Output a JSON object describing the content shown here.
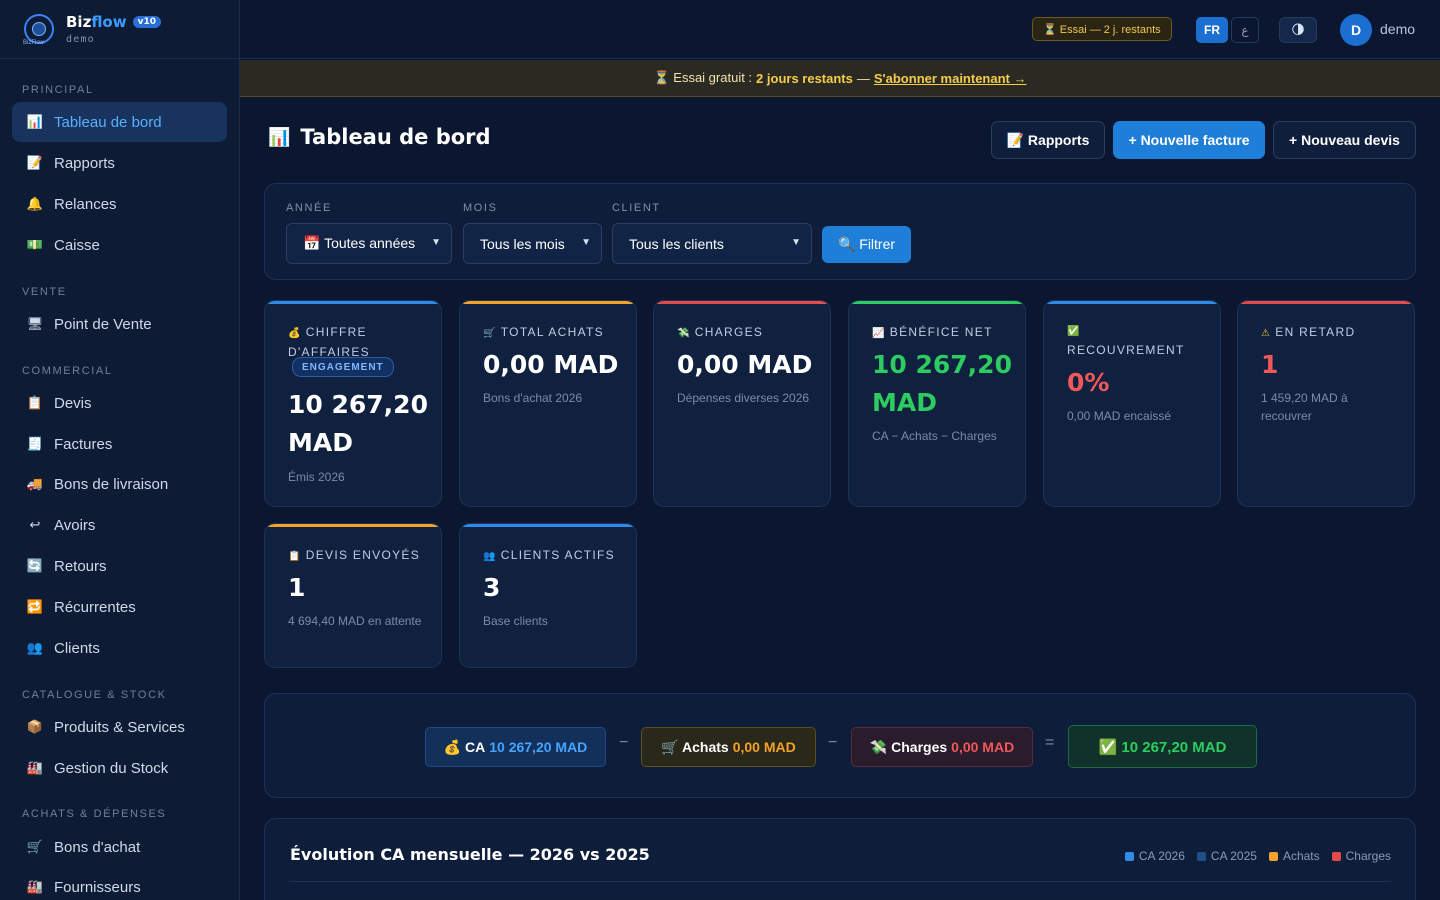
{
  "brand": {
    "name_a": "Biz",
    "name_b": "flow",
    "version": "v10",
    "subtitle": "demo",
    "logo_caption": "BizFlow"
  },
  "sidebar": {
    "sections": [
      "PRINCIPAL",
      "VENTE",
      "COMMERCIAL",
      "CATALOGUE & STOCK",
      "ACHATS & DÉPENSES"
    ],
    "items": [
      {
        "label": "Tableau de bord",
        "icon": "chart-icon",
        "glyph": "📊"
      },
      {
        "label": "Rapports",
        "icon": "document-icon",
        "glyph": "📝"
      },
      {
        "label": "Relances",
        "icon": "bell-icon",
        "glyph": "🔔"
      },
      {
        "label": "Caisse",
        "icon": "cash-icon",
        "glyph": "💵"
      },
      {
        "label": "Point de Vente",
        "icon": "monitor-icon",
        "glyph": "🖥"
      },
      {
        "label": "Devis",
        "icon": "clipboard-icon",
        "glyph": "📋"
      },
      {
        "label": "Factures",
        "icon": "receipt-icon",
        "glyph": "🧾"
      },
      {
        "label": "Bons de livraison",
        "icon": "truck-icon",
        "glyph": "🚚"
      },
      {
        "label": "Avoirs",
        "icon": "return-arrow-icon",
        "glyph": "↩"
      },
      {
        "label": "Retours",
        "icon": "refresh-icon",
        "glyph": "🔄"
      },
      {
        "label": "Récurrentes",
        "icon": "repeat-icon",
        "glyph": "🔁"
      },
      {
        "label": "Clients",
        "icon": "users-icon",
        "glyph": "👥"
      },
      {
        "label": "Produits & Services",
        "icon": "box-icon",
        "glyph": "📦"
      },
      {
        "label": "Gestion du Stock",
        "icon": "warehouse-icon",
        "glyph": "🏭"
      },
      {
        "label": "Bons d'achat",
        "icon": "cart-icon",
        "glyph": "🛒"
      },
      {
        "label": "Fournisseurs",
        "icon": "factory-icon",
        "glyph": "🏭"
      }
    ]
  },
  "topbar": {
    "trial": "⏳ Essai — 2 j. restants",
    "lang_fr": "FR",
    "lang_ar": "ع",
    "theme_glyph": "🌗",
    "avatar": "D",
    "user": "demo"
  },
  "banner": {
    "prefix": "⏳ Essai gratuit :",
    "bold": "2 jours restants",
    "dash": "—",
    "link": "S'abonner maintenant →"
  },
  "page": {
    "title": "Tableau de bord",
    "title_glyph": "📊",
    "buttons": {
      "reports": "📝 Rapports",
      "new_invoice": "+ Nouvelle facture",
      "new_quote": "+ Nouveau devis"
    }
  },
  "filters": {
    "year_label": "ANNÉE",
    "year_value": "📅 Toutes années",
    "month_label": "MOIS",
    "month_value": "Tous les mois",
    "client_label": "CLIENT",
    "client_value": "Tous les clients",
    "submit": "🔍 Filtrer"
  },
  "kpis": [
    {
      "glyph": "💰",
      "label": "CHIFFRE D'AFFAIRES",
      "badge": "ENGAGEMENT",
      "value": "10 267,20 MAD",
      "sub": "Émis 2026",
      "accent": "#2f8be8"
    },
    {
      "glyph": "🛒",
      "label": "TOTAL ACHATS",
      "value": "0,00 MAD",
      "sub": "Bons d'achat 2026",
      "accent": "#f3a32a"
    },
    {
      "glyph": "💸",
      "label": "CHARGES",
      "value": "0,00 MAD",
      "sub": "Dépenses diverses 2026",
      "accent": "#e34b4b"
    },
    {
      "glyph": "📈",
      "label": "BÉNÉFICE NET",
      "value": "10 267,20 MAD",
      "sub": "CA − Achats − Charges",
      "accent": "#2ecc60"
    },
    {
      "glyph": "✅",
      "label": "RECOUVREMENT",
      "value": "0%",
      "sub": "0,00 MAD encaissé",
      "accent": "#2f8be8"
    },
    {
      "glyph": "⚠",
      "label": "EN RETARD",
      "value": "1",
      "sub": "1 459,20 MAD à recouvrer",
      "accent": "#e34b4b"
    },
    {
      "glyph": "📋",
      "label": "DEVIS ENVOYÉS",
      "value": "1",
      "sub": "4 694,40 MAD en attente",
      "accent": "#f3a32a"
    },
    {
      "glyph": "👥",
      "label": "CLIENTS ACTIFS",
      "value": "3",
      "sub": "Base clients",
      "accent": "#2f8be8"
    }
  ],
  "formula": {
    "ca_label": "💰 CA",
    "ca_value": "10 267,20 MAD",
    "minus1": "−",
    "achats_label": "🛒 Achats",
    "achats_value": "0,00 MAD",
    "minus2": "−",
    "charges_label": "💸 Charges",
    "charges_value": "0,00 MAD",
    "equals": "=",
    "result": "✅ 10 267,20 MAD"
  },
  "chart": {
    "title": "Évolution CA mensuelle — 2026 vs 2025",
    "legend": [
      {
        "name": "CA 2026",
        "color": "#2f8be8"
      },
      {
        "name": "CA 2025",
        "color": "#1d4f8a"
      },
      {
        "name": "Achats",
        "color": "#f3a32a"
      },
      {
        "name": "Charges",
        "color": "#e34b4b"
      }
    ]
  }
}
